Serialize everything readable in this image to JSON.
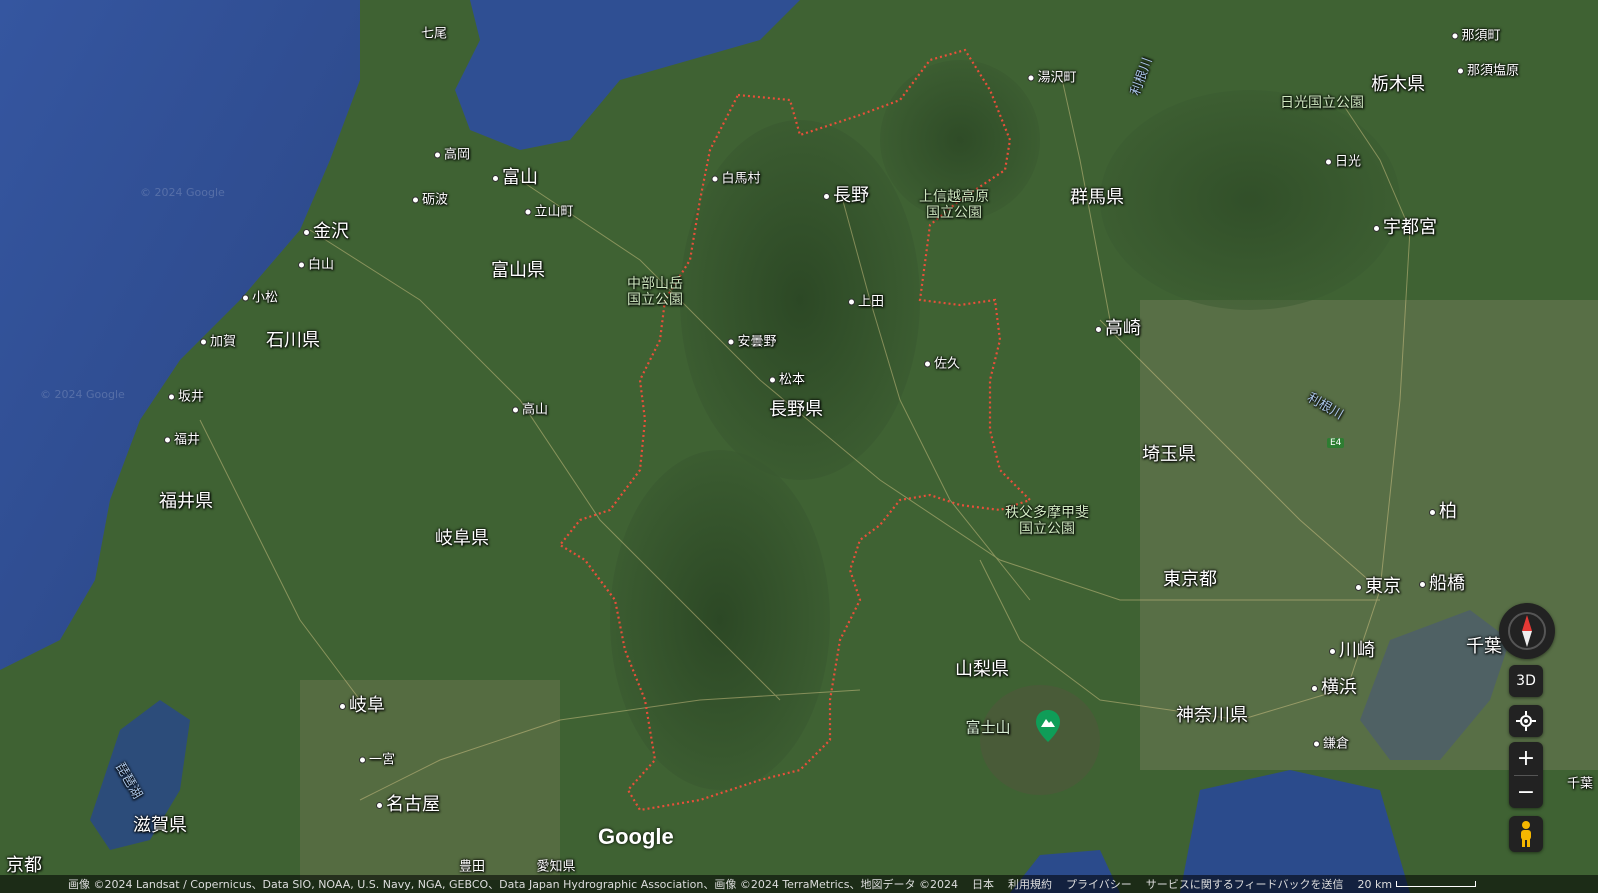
{
  "map": {
    "watermark": "© 2024 Google",
    "prefectures": [
      {
        "name": "富山県"
      },
      {
        "name": "石川県"
      },
      {
        "name": "福井県"
      },
      {
        "name": "岐阜県"
      },
      {
        "name": "長野県"
      },
      {
        "name": "群馬県"
      },
      {
        "name": "埼玉県"
      },
      {
        "name": "東京都"
      },
      {
        "name": "山梨県"
      },
      {
        "name": "神奈川県"
      },
      {
        "name": "栃木県"
      },
      {
        "name": "滋賀県"
      }
    ],
    "cities": [
      {
        "name": "七尾"
      },
      {
        "name": "高岡"
      },
      {
        "name": "富山"
      },
      {
        "name": "砺波"
      },
      {
        "name": "立山町"
      },
      {
        "name": "金沢"
      },
      {
        "name": "白山"
      },
      {
        "name": "小松"
      },
      {
        "name": "加賀"
      },
      {
        "name": "坂井"
      },
      {
        "name": "福井"
      },
      {
        "name": "高山"
      },
      {
        "name": "白馬村"
      },
      {
        "name": "長野"
      },
      {
        "name": "上田"
      },
      {
        "name": "安曇野"
      },
      {
        "name": "松本"
      },
      {
        "name": "佐久"
      },
      {
        "name": "湯沢町"
      },
      {
        "name": "那須町"
      },
      {
        "name": "那須塩原"
      },
      {
        "name": "日光"
      },
      {
        "name": "宇都宮"
      },
      {
        "name": "高崎"
      },
      {
        "name": "柏"
      },
      {
        "name": "東京"
      },
      {
        "name": "船橋"
      },
      {
        "name": "千葉"
      },
      {
        "name": "川崎"
      },
      {
        "name": "横浜"
      },
      {
        "name": "鎌倉"
      },
      {
        "name": "千葉"
      },
      {
        "name": "岐阜"
      },
      {
        "name": "一宮"
      },
      {
        "name": "名古屋"
      },
      {
        "name": "豊田"
      },
      {
        "name": "愛知県"
      },
      {
        "name": "京都"
      }
    ],
    "parks": [
      {
        "name": "中部山岳\n国立公園"
      },
      {
        "name": "上信越高原\n国立公園"
      },
      {
        "name": "秩父多摩甲斐\n国立公園"
      },
      {
        "name": "日光国立公園"
      }
    ],
    "rivers": [
      {
        "name": "利根川"
      },
      {
        "name": "利根川"
      },
      {
        "name": "琵琶湖"
      }
    ],
    "poi": {
      "name": "富士山",
      "icon": "mountain-marker-icon",
      "color": "#0f9d58"
    },
    "highway": "E4",
    "colors": {
      "boundary": "#e8503a",
      "sea": "#2d4a8a",
      "land": "#3f6233"
    }
  },
  "controls": {
    "compass_icon": "compass-icon",
    "three_d": "3D",
    "location_icon": "my-location-icon",
    "zoom_in": "+",
    "zoom_out": "−",
    "pegman_icon": "pegman-icon"
  },
  "branding": {
    "logo": "Google"
  },
  "attribution": {
    "imagery": "画像 ©2024 Landsat / Copernicus、Data SIO, NOAA, U.S. Navy, NGA, GEBCO、Data Japan Hydrographic Association、画像 ©2024 TerraMetrics、地図データ ©2024",
    "country": "日本",
    "terms": "利用規約",
    "privacy": "プライバシー",
    "feedback": "サービスに関するフィードバックを送信",
    "scale": "20 km"
  }
}
